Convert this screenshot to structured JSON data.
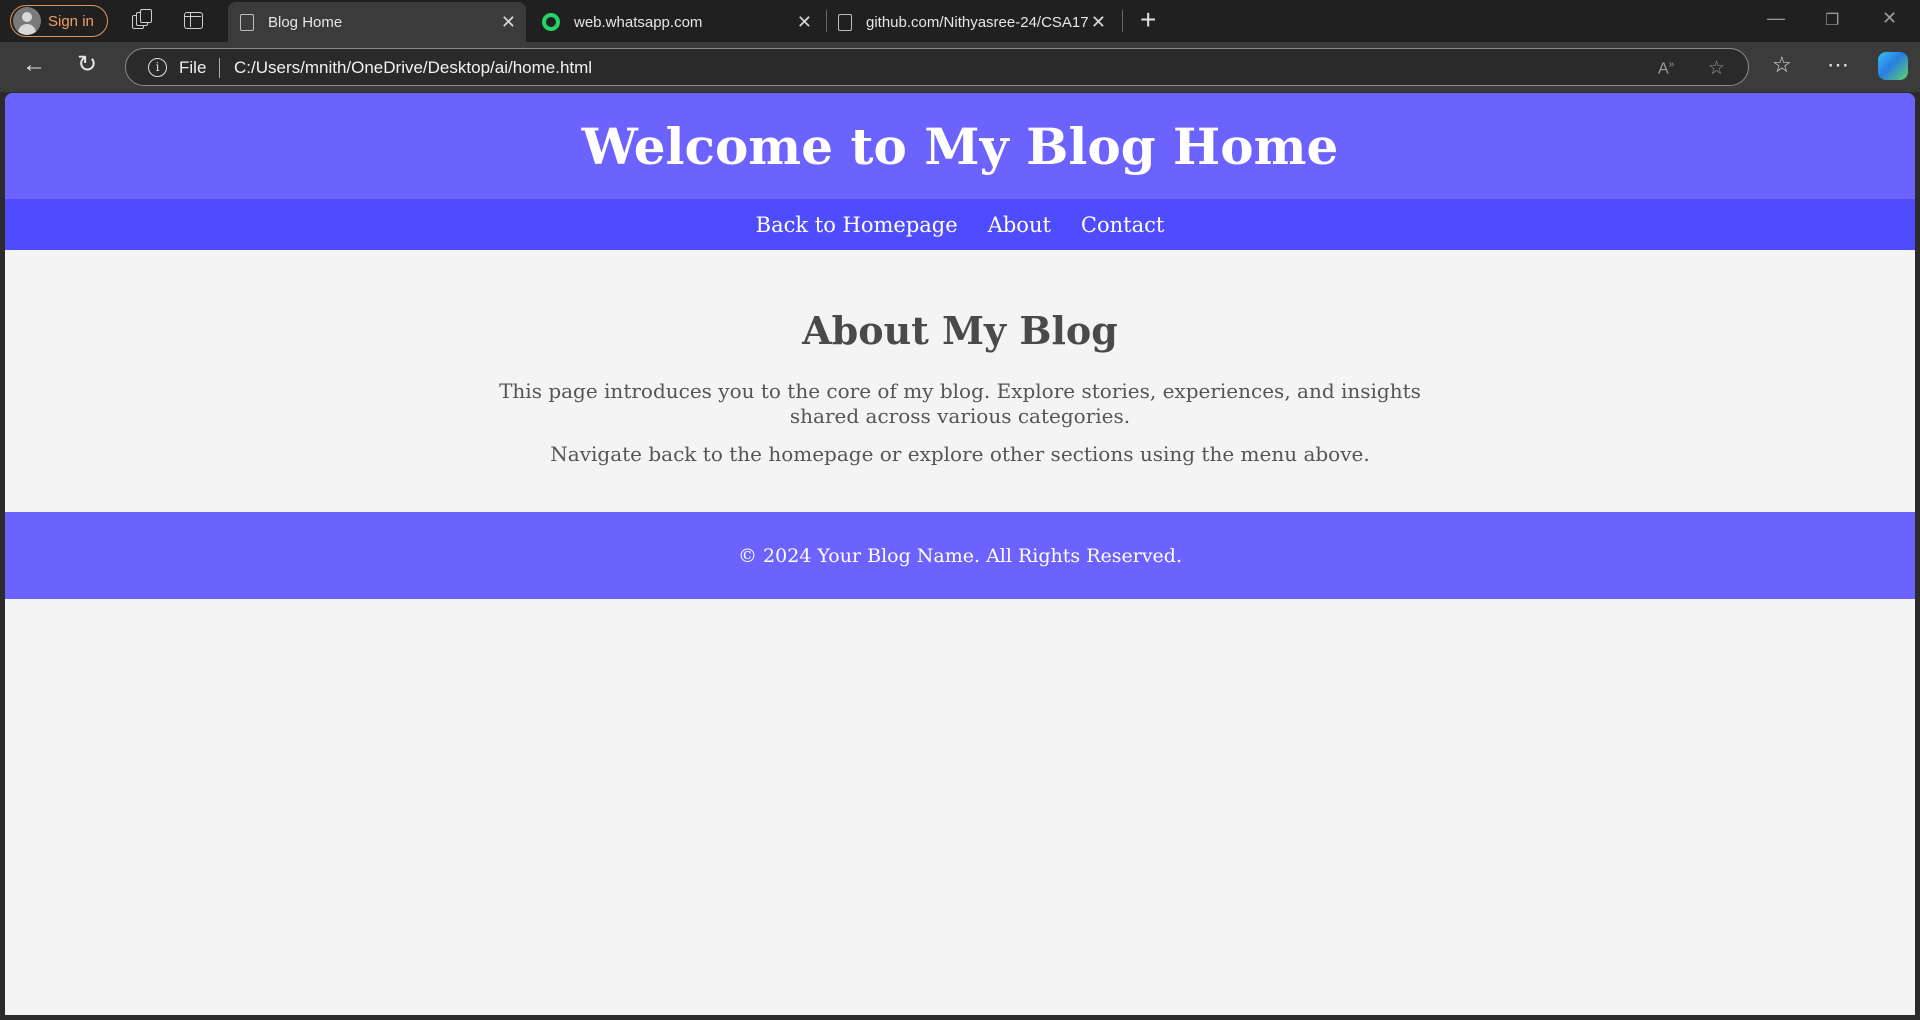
{
  "browser": {
    "signin_label": "Sign in",
    "tabs": [
      {
        "title": "Blog Home",
        "active": true
      },
      {
        "title": "web.whatsapp.com",
        "active": false
      },
      {
        "title": "github.com/Nithyasree-24/CSA17",
        "active": false
      }
    ],
    "address": {
      "scheme_label": "File",
      "url": "C:/Users/mnith/OneDrive/Desktop/ai/home.html"
    },
    "icons": {
      "back": "back-arrow-icon",
      "refresh": "refresh-icon",
      "info": "info-icon",
      "read_aloud": "read-aloud-icon",
      "favorite": "star-icon",
      "favorites": "favorites-icon",
      "more": "more-icon",
      "copilot": "copilot-icon"
    }
  },
  "page": {
    "header_title": "Welcome to My Blog Home",
    "nav": [
      "Back to Homepage",
      "About",
      "Contact"
    ],
    "section_title": "About My Blog",
    "paragraphs": [
      "This page introduces you to the core of my blog. Explore stories, experiences, and insights shared across various categories.",
      "Navigate back to the homepage or explore other sections using the menu above."
    ],
    "footer": "© 2024 Your Blog Name. All Rights Reserved."
  },
  "colors": {
    "header_bg": "#6c63ff",
    "nav_bg": "#4f4cff",
    "page_bg": "#f4f4f4",
    "heading_text": "#4a4a4a",
    "signin_accent": "#f0a060"
  }
}
